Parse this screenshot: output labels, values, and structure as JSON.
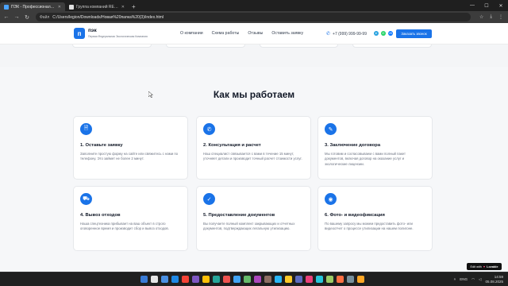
{
  "browser": {
    "tabs": [
      {
        "title": "ПЭК - Профессиональная у",
        "active": true,
        "favicon_color": "#4aa3ff"
      },
      {
        "title": "Группа компаний RED TIGER",
        "active": false,
        "favicon_color": "#e0e0e0"
      }
    ],
    "address_label": "Файл",
    "url": "C:/Users/legion/Downloads/Новая%20папка%20(3)/index.html"
  },
  "header": {
    "logo_letter": "п",
    "logo_name": "пэк",
    "logo_subtitle": "Первая Федеральная Экологическая Компания",
    "menu": [
      "О компании",
      "Схема работы",
      "Отзывы",
      "Оставить заявку"
    ],
    "phone": "+7 (999) 999-99-99",
    "order_button": "Заказать звонок",
    "socials": [
      {
        "name": "telegram-icon",
        "color": "#2aa3e0",
        "glyph": "➤"
      },
      {
        "name": "whatsapp-icon",
        "color": "#25d366",
        "glyph": "✆"
      },
      {
        "name": "vk-icon",
        "color": "#0a77ff",
        "glyph": "VK"
      }
    ]
  },
  "section": {
    "title": "Как мы работаем",
    "steps": [
      {
        "icon": "document-icon",
        "glyph": "🗎",
        "title": "1. Оставьте заявку",
        "text": "Заполните простую форму на сайте или свяжитесь с нами по телефону. Это займет не более 2 минут."
      },
      {
        "icon": "phone-icon",
        "glyph": "✆",
        "title": "2. Консультация и расчет",
        "text": "Наш специалист связывается с вами в течение 15 минут, уточняет детали и производит точный расчет стоимости услуг."
      },
      {
        "icon": "pen-icon",
        "glyph": "✎",
        "title": "3. Заключение договора",
        "text": "Мы готовим и согласовываем с вами полный пакет документов, включая договор на оказание услуг и экологические лицензии."
      },
      {
        "icon": "truck-icon",
        "glyph": "⛟",
        "title": "4. Вывоз отходов",
        "text": "Наша спецтехника прибывает на ваш объект в строго оговоренное время и производит сбор и вывоз отходов."
      },
      {
        "icon": "check-circle-icon",
        "glyph": "✓",
        "title": "5. Предоставление документов",
        "text": "Вы получаете полный комплект закрывающих и отчетных документов, подтверждающих легальную утилизацию."
      },
      {
        "icon": "camera-icon",
        "glyph": "◉",
        "title": "6. Фото- и видеофиксация",
        "text": "По вашему запросу мы можем предоставить фото- или видеоотчет о процессе утилизации на нашем полигоне."
      }
    ]
  },
  "badge": {
    "label": "Edit with",
    "brand": "Lovable"
  },
  "taskbar": {
    "lang": "ENG",
    "time": "14:59",
    "date": "05.08.2025",
    "icon_colors": [
      "#3a7bd5",
      "#e6e6e6",
      "#4a90e2",
      "#1e88e5",
      "#f44336",
      "#7e57c2",
      "#ffc107",
      "#26a69a",
      "#ef5350",
      "#42a5f5",
      "#66bb6a",
      "#ab47bc",
      "#8d6e63",
      "#29b6f6",
      "#ffca28",
      "#5c6bc0",
      "#ec407a",
      "#26c6da",
      "#9ccc65",
      "#ff7043",
      "#78909c",
      "#ffa726"
    ]
  }
}
